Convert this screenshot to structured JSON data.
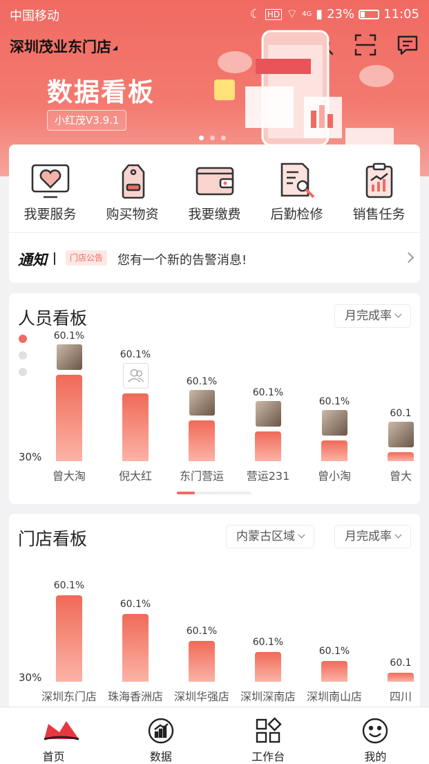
{
  "status_bar": {
    "carrier": "中国移动",
    "battery": "23%",
    "time": "11:05",
    "network": "4G"
  },
  "header": {
    "store_name": "深圳茂业东门店"
  },
  "banner": {
    "title": "数据看板",
    "version": "小红茂V3.9.1",
    "slides": 3,
    "active_slide": 1
  },
  "services": [
    {
      "label": "我要服务",
      "icon": "heart-card-icon"
    },
    {
      "label": "购买物资",
      "icon": "tag-icon"
    },
    {
      "label": "我要缴费",
      "icon": "wallet-icon"
    },
    {
      "label": "后勤检修",
      "icon": "document-wrench-icon"
    },
    {
      "label": "销售任务",
      "icon": "clipboard-chart-icon"
    }
  ],
  "notice": {
    "label": "通知",
    "tag": "门店公告",
    "message": "您有一个新的告警消息!"
  },
  "staff_board": {
    "title": "人员看板",
    "filter": "月完成率",
    "y_label": "30%",
    "people": [
      {
        "name": "曾大淘",
        "value": "60.1%",
        "fill": 1.0,
        "avatar": "photo"
      },
      {
        "name": "倪大红",
        "value": "60.1%",
        "fill": 0.78,
        "avatar": "placeholder"
      },
      {
        "name": "东门营运",
        "value": "60.1%",
        "fill": 0.47,
        "avatar": "photo"
      },
      {
        "name": "营运231",
        "value": "60.1%",
        "fill": 0.34,
        "avatar": "photo"
      },
      {
        "name": "曾小淘",
        "value": "60.1%",
        "fill": 0.24,
        "avatar": "photo"
      },
      {
        "name": "曾大",
        "value": "60.1",
        "fill": 0.1,
        "avatar": "photo"
      }
    ]
  },
  "store_board": {
    "title": "门店看板",
    "region_filter": "内蒙古区域",
    "filter": "月完成率",
    "y_label": "30%",
    "stores": [
      {
        "name": "深圳东门店",
        "value": "60.1%",
        "fill": 1.0
      },
      {
        "name": "珠海香洲店",
        "value": "60.1%",
        "fill": 0.78
      },
      {
        "name": "深圳华强店",
        "value": "60.1%",
        "fill": 0.47
      },
      {
        "name": "深圳深南店",
        "value": "60.1%",
        "fill": 0.34
      },
      {
        "name": "深圳南山店",
        "value": "60.1%",
        "fill": 0.24
      },
      {
        "name": "四川",
        "value": "60.1",
        "fill": 0.1
      }
    ]
  },
  "tabbar": [
    {
      "label": "首页",
      "icon": "home-crown-icon"
    },
    {
      "label": "数据",
      "icon": "chart-icon"
    },
    {
      "label": "工作台",
      "icon": "grid-icon"
    },
    {
      "label": "我的",
      "icon": "smile-icon"
    }
  ],
  "colors": {
    "accent": "#f06a62",
    "bar_top": "#f06a58",
    "bar_bottom": "#fbb3a6"
  }
}
